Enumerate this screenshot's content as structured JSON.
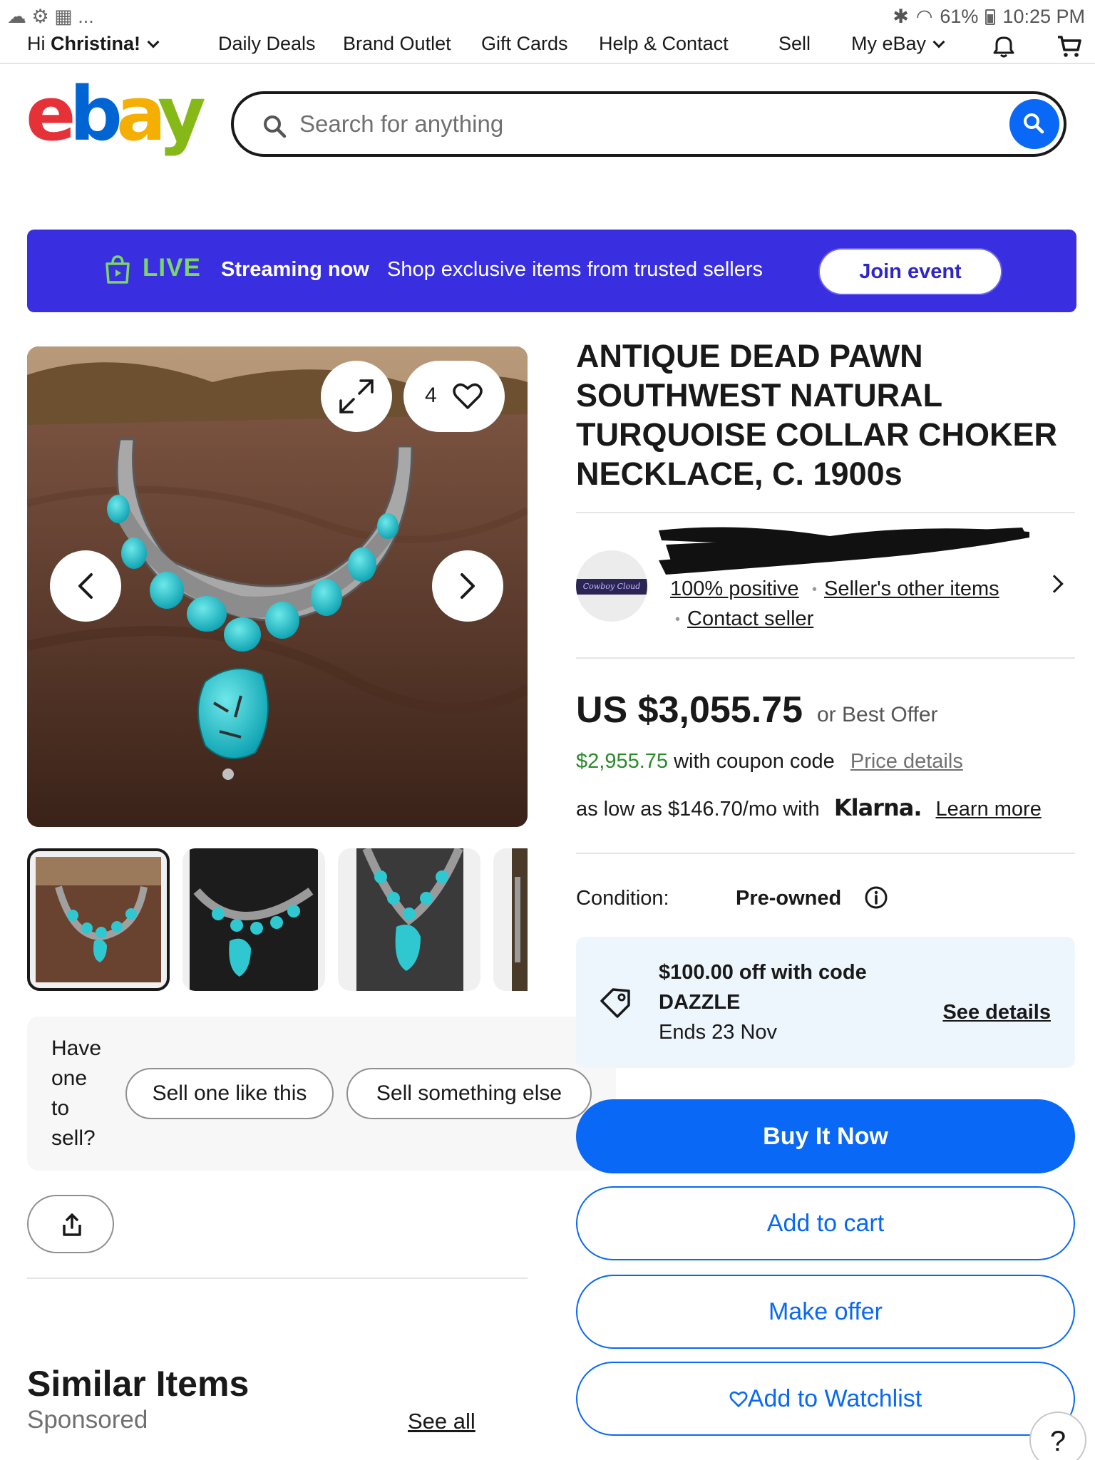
{
  "status_bar": {
    "left_glyphs": "☁ ⚙ ▦ ...",
    "battery": "61%",
    "time": "10:25 PM"
  },
  "top_nav": {
    "greeting_prefix": "Hi ",
    "greeting_name": "Christina!",
    "links": [
      "Daily Deals",
      "Brand Outlet",
      "Gift Cards",
      "Help & Contact",
      "Sell",
      "My eBay"
    ]
  },
  "header": {
    "logo": {
      "e": "e",
      "b": "b",
      "a": "a",
      "y": "y"
    },
    "search_placeholder": "Search for anything"
  },
  "live_banner": {
    "badge": "LIVE",
    "streaming": "Streaming now",
    "message": "Shop exclusive items from trusted sellers",
    "cta": "Join event"
  },
  "gallery": {
    "watch_count": "4"
  },
  "sell_panel": {
    "question": "Have one to sell?",
    "btn_one": "Sell one like this",
    "btn_two": "Sell something else"
  },
  "similar": {
    "title": "Similar Items",
    "sponsored": "Sponsored",
    "see_all": "See all"
  },
  "listing": {
    "title": "ANTIQUE DEAD PAWN SOUTHWEST NATURAL TURQUOISE COLLAR CHOKER NECKLACE, C. 1900s",
    "seller": {
      "feedback": "100% positive",
      "other_items": "Seller's other items",
      "contact": "Contact seller"
    },
    "price": "US $3,055.75",
    "best_offer": "or Best Offer",
    "coupon_price": "$2,955.75",
    "coupon_text": "with coupon code",
    "price_details": "Price details",
    "klarna_prefix": "as low as $146.70/mo with",
    "klarna_brand": "Klarna.",
    "learn_more": "Learn more",
    "condition_label": "Condition:",
    "condition_value": "Pre-owned",
    "promo": {
      "line1": "$100.00 off with code",
      "code": "DAZZLE",
      "ends": "Ends 23 Nov",
      "see_details": "See details"
    },
    "buttons": {
      "buy": "Buy It Now",
      "cart": "Add to cart",
      "offer": "Make offer",
      "watch": "Add to Watchlist"
    }
  },
  "help_label": "?",
  "colors": {
    "ebay_blue": "#0968f6",
    "live_purple": "#3a2fe0",
    "live_green": "#7bd665",
    "coupon_green": "#2a8a2a"
  }
}
